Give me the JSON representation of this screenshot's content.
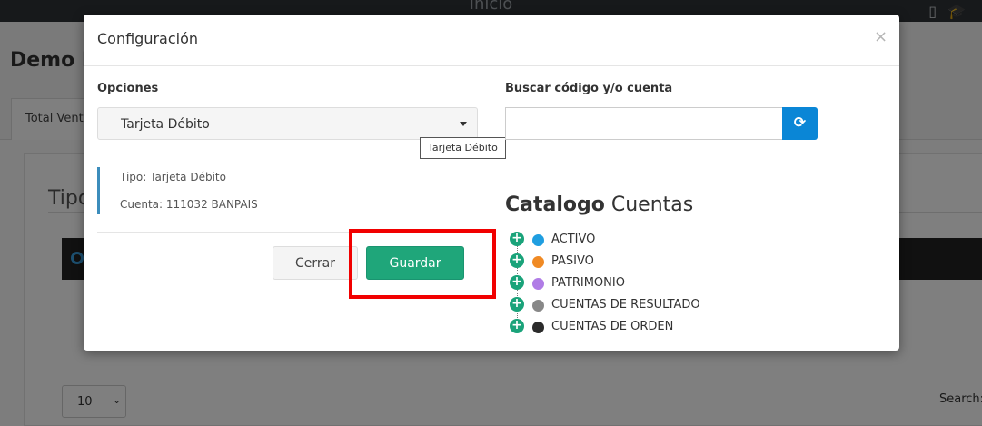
{
  "background": {
    "topbar_title": "Inicio",
    "page_title": "Demo P",
    "tab_label": "Total Venta",
    "section_title": "Tipo",
    "page_size": "10",
    "search_label": "Search:"
  },
  "modal": {
    "title": "Configuración",
    "close_label": "×",
    "options_label": "Opciones",
    "options_selected": "Tarjeta Débito",
    "tooltip": "Tarjeta Débito",
    "info_tipo": "Tipo: Tarjeta Débito",
    "info_cuenta": "Cuenta: 111032 BANPAIS",
    "cerrar_label": "Cerrar",
    "guardar_label": "Guardar",
    "search_label": "Buscar código y/o cuenta",
    "search_value": "",
    "refresh_icon": "refresh-icon",
    "catalog_title_bold": "Catalogo",
    "catalog_title_rest": "Cuentas",
    "tree": [
      {
        "label": "ACTIVO",
        "color": "#1f9ee0"
      },
      {
        "label": "PASIVO",
        "color": "#f08a24"
      },
      {
        "label": "PATRIMONIO",
        "color": "#b07ce6"
      },
      {
        "label": "CUENTAS DE RESULTADO",
        "color": "#888888"
      },
      {
        "label": "CUENTAS DE ORDEN",
        "color": "#2b2b2b"
      }
    ]
  },
  "colors": {
    "guardar": "#1fa67a",
    "refresh": "#0a86d6",
    "highlight": "#f10000"
  }
}
